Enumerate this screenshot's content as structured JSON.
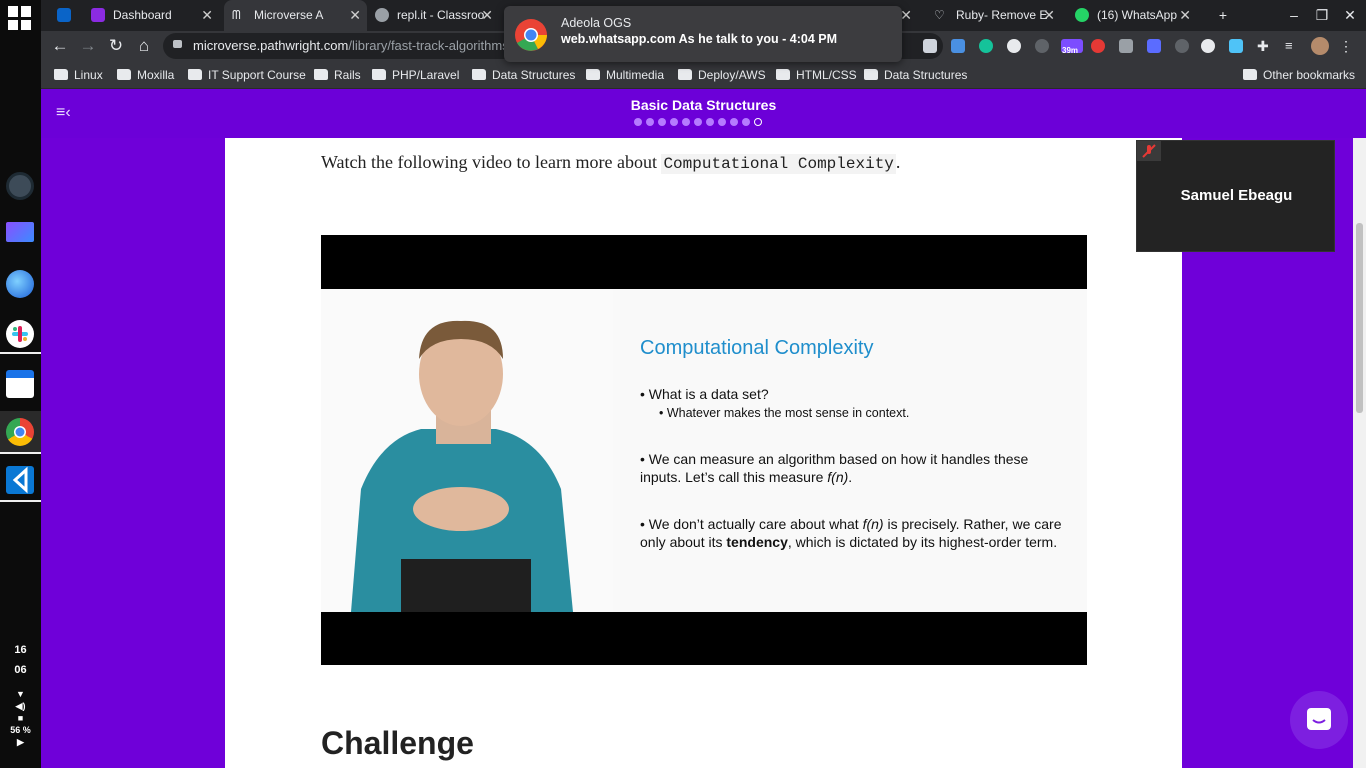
{
  "os": {
    "clock_hour": "16",
    "clock_minute": "06",
    "battery": "56 %"
  },
  "tabs": [
    {
      "label": "Dashboard",
      "icon": "microverse-icon"
    },
    {
      "label": "Microverse A",
      "icon": "microverse-icon"
    },
    {
      "label": "repl.it - Classroo",
      "icon": "replit-icon"
    },
    {
      "label": "Ruby- Remove E",
      "icon": "heart-icon"
    },
    {
      "label": "(16) WhatsApp",
      "icon": "whatsapp-icon"
    }
  ],
  "omnibox": {
    "host": "microverse.pathwright.com",
    "path": "/library/fast-track-algorithms"
  },
  "extension_badge": "39m",
  "bookmarks": [
    "Linux",
    "Moxilla",
    "IT Support Course",
    "Rails",
    "PHP/Laravel",
    "Data Structures",
    "Multimedia",
    "Deploy/AWS",
    "HTML/CSS",
    "Data Structures"
  ],
  "other_bookmarks": "Other bookmarks",
  "notification": {
    "sender": "Adeola OGS",
    "site": "web.whatsapp.com",
    "message": "As he talk to you - 4:04 PM"
  },
  "page": {
    "course_title": "Basic Data Structures",
    "intro_text": "Watch the following video to learn more about",
    "intro_code": "Computational Complexity",
    "intro_end": ".",
    "challenge_heading": "Challenge"
  },
  "slide": {
    "title": "Computational Complexity",
    "bullet1": "What is a data set?",
    "bullet1_sub": "Whatever makes the most sense in context.",
    "bullet2_a": "We can measure an algorithm based on how it handles these inputs. Let’s call this measure",
    "bullet2_fn": "f(n)",
    "bullet2_end": ".",
    "bullet3_a": "We don’t actually care about what",
    "bullet3_fn": "f(n)",
    "bullet3_b": "is precisely. Rather, we care only about its",
    "bullet3_bold": "tendency",
    "bullet3_c": ", which is dictated by its highest-order term."
  },
  "video_call": {
    "participant": "Samuel Ebeagu"
  },
  "colors": {
    "brand": "#6c00d8",
    "slide_title": "#1f8ecc"
  }
}
